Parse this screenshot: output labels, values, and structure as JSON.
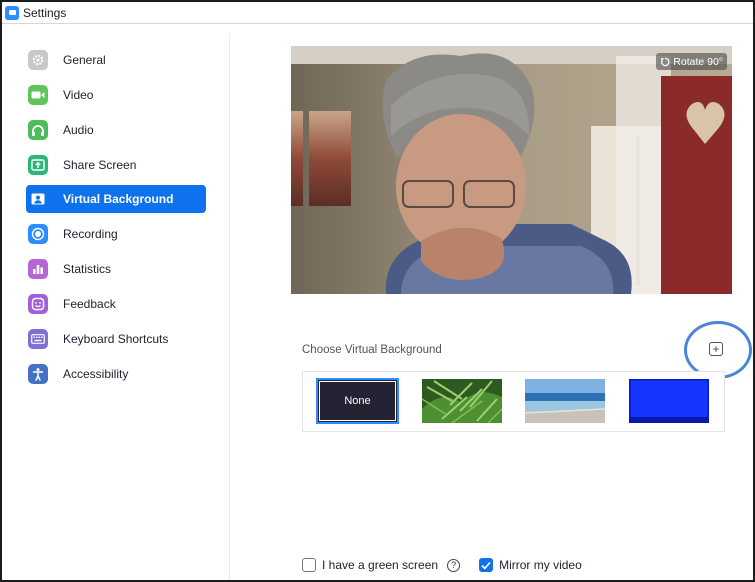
{
  "window": {
    "title": "Settings"
  },
  "sidebar": {
    "items": [
      {
        "label": "General",
        "icon": "gear-icon",
        "color": "#c8c8c8"
      },
      {
        "label": "Video",
        "icon": "video-camera-icon",
        "color": "#5fc45a"
      },
      {
        "label": "Audio",
        "icon": "headphones-icon",
        "color": "#4cbc5c"
      },
      {
        "label": "Share Screen",
        "icon": "share-screen-icon",
        "color": "#2db67a"
      },
      {
        "label": "Virtual Background",
        "icon": "person-card-icon",
        "color": "#0e72ed",
        "active": true
      },
      {
        "label": "Recording",
        "icon": "record-icon",
        "color": "#2d8cff"
      },
      {
        "label": "Statistics",
        "icon": "bar-chart-icon",
        "color": "#b565d8"
      },
      {
        "label": "Feedback",
        "icon": "smiley-icon",
        "color": "#a35ed8"
      },
      {
        "label": "Keyboard Shortcuts",
        "icon": "keyboard-icon",
        "color": "#7c6fd6"
      },
      {
        "label": "Accessibility",
        "icon": "accessibility-icon",
        "color": "#4570c6"
      }
    ]
  },
  "video_preview": {
    "rotate_label": "Rotate 90°"
  },
  "virtual_background": {
    "section_label": "Choose Virtual Background",
    "add_symbol": "+",
    "options": [
      {
        "label": "None",
        "selected": true
      },
      {
        "kind": "ferns"
      },
      {
        "kind": "beach"
      },
      {
        "kind": "blue"
      }
    ]
  },
  "footer": {
    "green_screen_label": "I have a green screen",
    "green_screen_checked": false,
    "mirror_label": "Mirror my video",
    "mirror_checked": true,
    "help_symbol": "?"
  },
  "colors": {
    "accent": "#0e72ed",
    "annotation": "#4a86d8"
  }
}
